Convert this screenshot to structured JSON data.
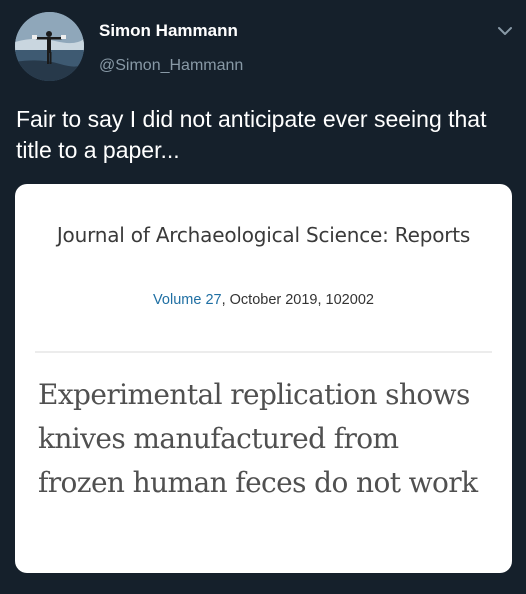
{
  "tweet": {
    "author": {
      "display_name": "Simon Hammann",
      "handle": "@Simon_Hammann",
      "avatar_icon": "profile-photo"
    },
    "menu_icon": "chevron-down-icon",
    "text": "Fair to say I did not anticipate ever seeing that title to a paper..."
  },
  "card": {
    "journal": "Journal of Archaeological Science: Reports",
    "volume_label": "Volume 27",
    "issue_info": ", October 2019, 102002",
    "paper_title": "Experimental replication shows knives manufactured from frozen human feces do not work"
  },
  "colors": {
    "background": "#15202b",
    "text_primary": "#ffffff",
    "text_secondary": "#8899a6",
    "card_background": "#ffffff",
    "link": "#1f6fa3"
  }
}
